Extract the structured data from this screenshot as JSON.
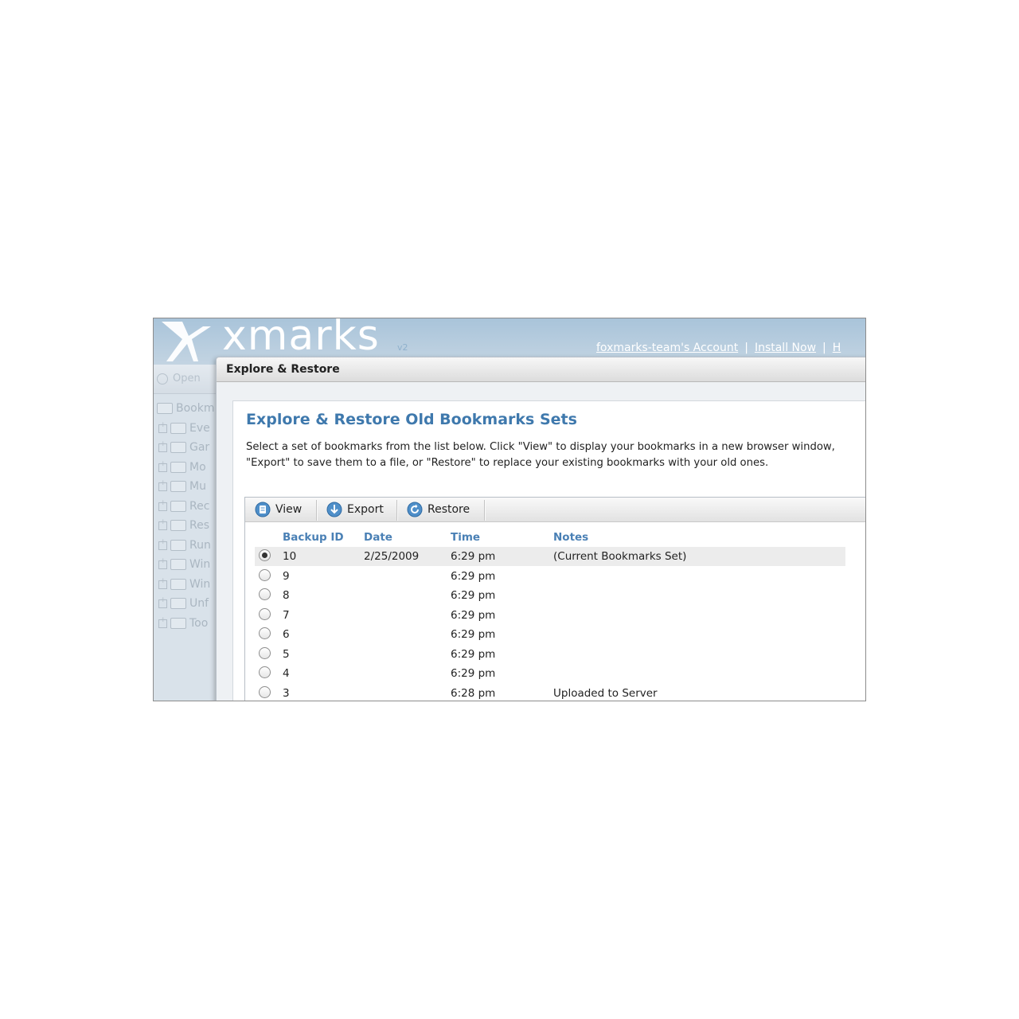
{
  "header": {
    "logo_text": "xmarks",
    "version": "v2",
    "links": [
      "foxmarks-team's Account",
      "Install Now",
      "H"
    ]
  },
  "background_app": {
    "open_label": "Open",
    "tree_items": [
      "Bookm",
      "Eve",
      "Gar",
      "Mo",
      "Mu",
      "Rec",
      "Res",
      "Run",
      "Win",
      "Win",
      "Unf",
      "Too"
    ]
  },
  "dialog": {
    "title": "Explore & Restore",
    "heading": "Explore & Restore Old Bookmarks Sets",
    "description": "Select a set of bookmarks from the list below. Click \"View\" to display your bookmarks in a new browser window, \"Export\" to save them to a file, or \"Restore\" to replace your existing bookmarks with your old ones.",
    "toolbar": {
      "view_label": "View",
      "export_label": "Export",
      "restore_label": "Restore"
    },
    "columns": {
      "backup_id": "Backup ID",
      "date": "Date",
      "time": "Time",
      "notes": "Notes"
    },
    "rows": [
      {
        "id": "10",
        "date": "2/25/2009",
        "time": "6:29 pm",
        "notes": "(Current Bookmarks Set)",
        "selected": true
      },
      {
        "id": "9",
        "date": "",
        "time": "6:29 pm",
        "notes": "",
        "selected": false
      },
      {
        "id": "8",
        "date": "",
        "time": "6:29 pm",
        "notes": "",
        "selected": false
      },
      {
        "id": "7",
        "date": "",
        "time": "6:29 pm",
        "notes": "",
        "selected": false
      },
      {
        "id": "6",
        "date": "",
        "time": "6:29 pm",
        "notes": "",
        "selected": false
      },
      {
        "id": "5",
        "date": "",
        "time": "6:29 pm",
        "notes": "",
        "selected": false
      },
      {
        "id": "4",
        "date": "",
        "time": "6:29 pm",
        "notes": "",
        "selected": false
      },
      {
        "id": "3",
        "date": "",
        "time": "6:28 pm",
        "notes": "Uploaded to Server",
        "selected": false
      }
    ]
  },
  "colors": {
    "accent": "#3f79ad",
    "column_header": "#4a80b5",
    "header_band": "#a9c4da"
  },
  "icons": [
    "xmarks-logo-icon",
    "view-icon",
    "export-icon",
    "restore-icon",
    "radio-icon",
    "folder-icon",
    "expand-icon"
  ]
}
